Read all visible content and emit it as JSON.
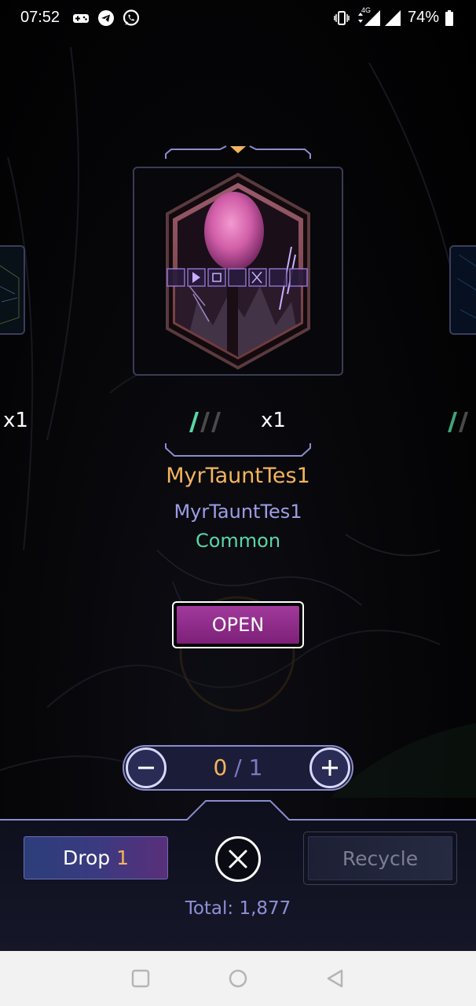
{
  "status_bar": {
    "time": "07:52",
    "network": "4G",
    "battery": "74%"
  },
  "carousel": {
    "left_qty": "x1",
    "main_qty": "x1",
    "rarity_level": 1,
    "rarity_max": 3
  },
  "item": {
    "title": "MyrTauntTes1",
    "subtitle": "MyrTauntTes1",
    "rarity": "Common"
  },
  "actions": {
    "open_label": "OPEN",
    "drop_label": "Drop",
    "drop_count": "1",
    "recycle_label": "Recycle"
  },
  "stepper": {
    "current": "0",
    "separator": "/",
    "max": "1"
  },
  "total": "Total: 1,877",
  "colors": {
    "accent_gold": "#f4b45c",
    "accent_lavender": "#9d9ee6",
    "rarity_common": "#5ad7a6",
    "open_button": "#a13a9c"
  },
  "icons": [
    "game-controller-icon",
    "telegram-icon",
    "whatsapp-icon",
    "vibrate-icon",
    "signal-icon",
    "battery-icon",
    "minus-icon",
    "plus-icon",
    "close-icon",
    "nav-recents-icon",
    "nav-home-icon",
    "nav-back-icon"
  ]
}
